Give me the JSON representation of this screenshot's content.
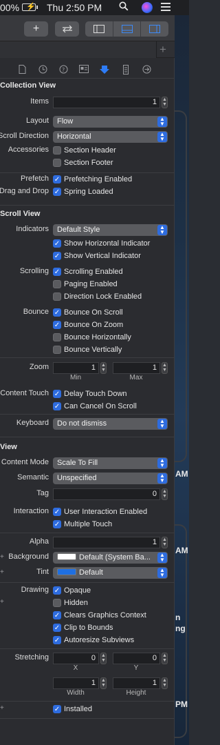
{
  "menubar": {
    "battery_pct": "00%",
    "clock": "Thu 2:50 PM"
  },
  "desktop_fragments": [
    "AM",
    "AM",
    "n",
    "ng",
    "PM"
  ],
  "collection_view": {
    "title": "Collection View",
    "items_label": "Items",
    "items_value": "1",
    "layout_label": "Layout",
    "layout_value": "Flow",
    "scroll_direction_label": "Scroll Direction",
    "scroll_direction_value": "Horizontal",
    "accessories_label": "Accessories",
    "section_header": "Section Header",
    "section_footer": "Section Footer",
    "prefetch_label": "Prefetch",
    "prefetching_enabled": "Prefetching Enabled",
    "drag_drop_label": "Drag and Drop",
    "spring_loaded": "Spring Loaded"
  },
  "scroll_view": {
    "title": "Scroll View",
    "indicators_label": "Indicators",
    "indicators_value": "Default Style",
    "show_horizontal": "Show Horizontal Indicator",
    "show_vertical": "Show Vertical Indicator",
    "scrolling_label": "Scrolling",
    "scrolling_enabled": "Scrolling Enabled",
    "paging_enabled": "Paging Enabled",
    "direction_lock": "Direction Lock Enabled",
    "bounce_label": "Bounce",
    "bounce_on_scroll": "Bounce On Scroll",
    "bounce_on_zoom": "Bounce On Zoom",
    "bounce_horizontally": "Bounce Horizontally",
    "bounce_vertically": "Bounce Vertically",
    "zoom_label": "Zoom",
    "zoom_min": "1",
    "zoom_max": "1",
    "min_label": "Min",
    "max_label": "Max",
    "content_touch_label": "Content Touch",
    "delay_touch_down": "Delay Touch Down",
    "can_cancel": "Can Cancel On Scroll",
    "keyboard_label": "Keyboard",
    "keyboard_value": "Do not dismiss"
  },
  "view": {
    "title": "View",
    "content_mode_label": "Content Mode",
    "content_mode_value": "Scale To Fill",
    "semantic_label": "Semantic",
    "semantic_value": "Unspecified",
    "tag_label": "Tag",
    "tag_value": "0",
    "interaction_label": "Interaction",
    "user_interaction": "User Interaction Enabled",
    "multiple_touch": "Multiple Touch",
    "alpha_label": "Alpha",
    "alpha_value": "1",
    "background_label": "Background",
    "background_value": "Default (System Ba...",
    "tint_label": "Tint",
    "tint_value": "Default",
    "drawing_label": "Drawing",
    "opaque": "Opaque",
    "hidden": "Hidden",
    "clears_graphics": "Clears Graphics Context",
    "clip_to_bounds": "Clip to Bounds",
    "autoresize": "Autoresize Subviews",
    "stretching_label": "Stretching",
    "x_value": "0",
    "y_value": "0",
    "x_label": "X",
    "y_label": "Y",
    "width_value": "1",
    "height_value": "1",
    "width_label": "Width",
    "height_label": "Height",
    "installed": "Installed"
  },
  "colors": {
    "accent": "#2e6cdf",
    "checkbox_on": "#2e6cdf",
    "tint_swatch": "#1f6fe0",
    "background_swatch": "#ffffff"
  }
}
